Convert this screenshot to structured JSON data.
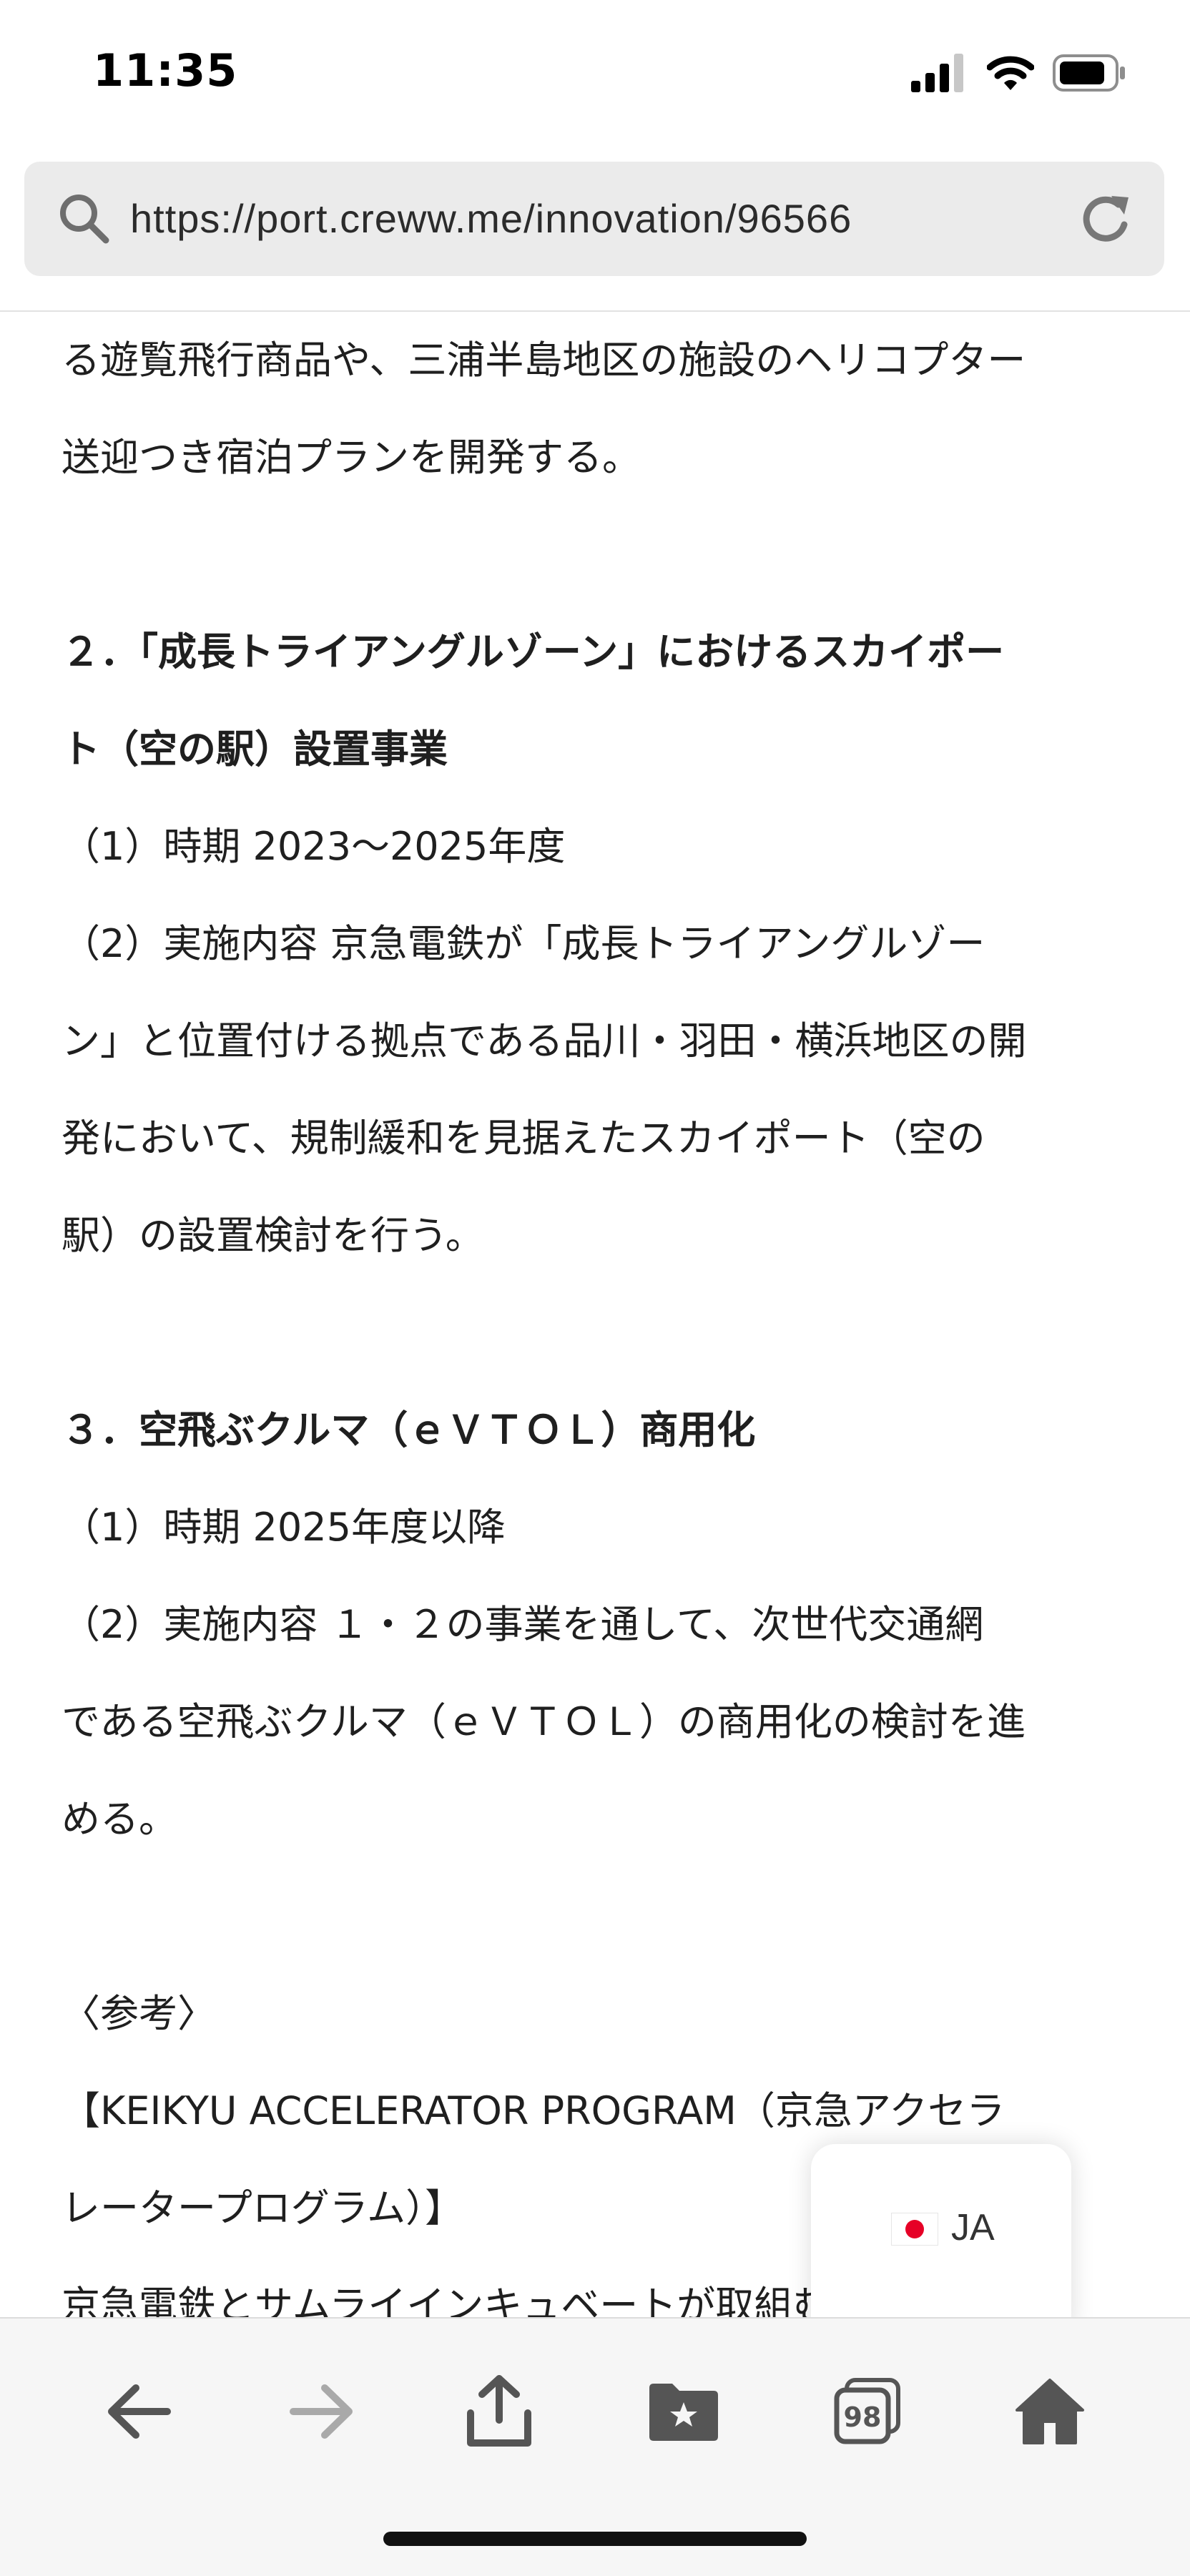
{
  "status_bar": {
    "time": "11:35"
  },
  "url_bar": {
    "url": "https://port.creww.me/innovation/96566"
  },
  "content": {
    "paragraphs": [
      {
        "text": "る遊覧飛行商品や、三浦半島地区の施設のヘリコプター",
        "bold": false
      },
      {
        "text": "送迎つき宿泊プランを開発する。",
        "bold": false
      },
      {
        "text": "２．「成長トライアングルゾーン」におけるスカイポー",
        "bold": true
      },
      {
        "text": "ト（空の駅）設置事業",
        "bold": true
      },
      {
        "text": "（1）時期  2023〜2025年度",
        "bold": false
      },
      {
        "text": "（2）実施内容  京急電鉄が「成長トライアングルゾー",
        "bold": false
      },
      {
        "text": "ン」と位置付ける拠点である品川・羽田・横浜地区の開",
        "bold": false
      },
      {
        "text": "発において、規制緩和を見据えたスカイポート（空の",
        "bold": false
      },
      {
        "text": "駅）の設置検討を行う。",
        "bold": false
      },
      {
        "text": "３．空飛ぶクルマ（ｅＶＴＯＬ）商用化",
        "bold": true
      },
      {
        "text": "（1）時期  2025年度以降",
        "bold": false
      },
      {
        "text": "（2）実施内容  １・２の事業を通して、次世代交通網",
        "bold": false
      },
      {
        "text": "である空飛ぶクルマ（ｅＶＴＯＬ）の商用化の検討を進",
        "bold": false
      },
      {
        "text": "める。",
        "bold": false
      },
      {
        "text": "〈参考〉",
        "bold": false
      },
      {
        "text": "【KEIKYU ACCELERATOR PROGRAM（京急アクセラ",
        "bold": false
      },
      {
        "text": "レータープログラム）】",
        "bold": false
      },
      {
        "text": "京急電鉄とサムライインキュベートが取組むアクセラビ",
        "bold": false
      }
    ]
  },
  "language_chip": {
    "label": "JA"
  },
  "toolbar": {
    "tabs_count": "98"
  },
  "colors": {
    "flag_red": "#e60026",
    "toolbar_icon": "#555555",
    "toolbar_icon_disabled": "#a9a9a9"
  }
}
